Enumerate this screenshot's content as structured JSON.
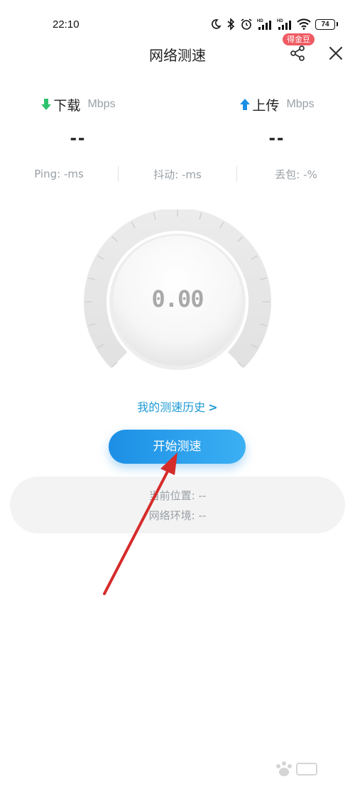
{
  "status_bar": {
    "time": "22:10",
    "battery": "74"
  },
  "header": {
    "title": "网络测速",
    "badge": "得金豆"
  },
  "download": {
    "label": "下载",
    "unit": "Mbps",
    "value": "--"
  },
  "upload": {
    "label": "上传",
    "unit": "Mbps",
    "value": "--"
  },
  "metrics": {
    "ping": "Ping: -ms",
    "jitter": "抖动: -ms",
    "loss": "丢包: -%"
  },
  "gauge": {
    "value": "0.00"
  },
  "history_link": "我的测速历史",
  "start_button": "开始测速",
  "info": {
    "location": "当前位置: --",
    "network": "网络环境: --"
  },
  "colors": {
    "accent": "#1f9ad6",
    "download_arrow": "#2fc26d",
    "upload_arrow": "#1a8fe3",
    "badge": "#ef5b63",
    "annotation_arrow": "#d62b2b"
  }
}
